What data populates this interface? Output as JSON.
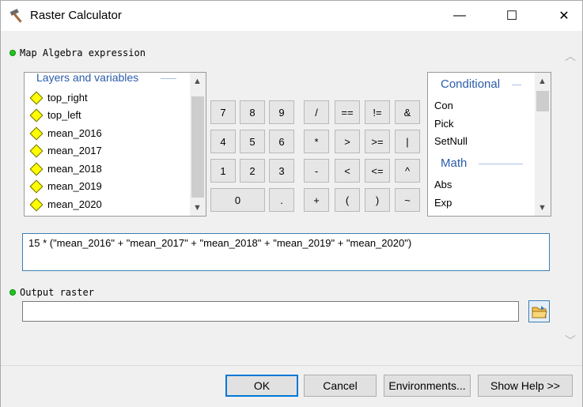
{
  "window": {
    "title": "Raster Calculator",
    "minimize": "—",
    "maximize": "☐",
    "close": "✕"
  },
  "expression_label": "Map Algebra expression",
  "layers": {
    "legend": "Layers and variables",
    "items": [
      "top_right",
      "top_left",
      "mean_2016",
      "mean_2017",
      "mean_2018",
      "mean_2019",
      "mean_2020"
    ]
  },
  "keypad": {
    "rows": [
      [
        "7",
        "8",
        "9",
        "/",
        "==",
        "!=",
        "&"
      ],
      [
        "4",
        "5",
        "6",
        "*",
        ">",
        ">=",
        "|"
      ],
      [
        "1",
        "2",
        "3",
        "-",
        "<",
        "<=",
        "^"
      ],
      [
        "0",
        ".",
        "+",
        "(",
        ")",
        "~"
      ]
    ]
  },
  "functions": {
    "categories": [
      {
        "name": "Conditional",
        "items": [
          "Con",
          "Pick",
          "SetNull"
        ]
      },
      {
        "name": "Math",
        "items": [
          "Abs",
          "Exp"
        ]
      }
    ]
  },
  "expression": "15 * (\"mean_2016\" + \"mean_2017\" + \"mean_2018\" + \"mean_2019\" + \"mean_2020\")",
  "output_label": "Output raster",
  "output_value": "",
  "buttons": {
    "ok": "OK",
    "cancel": "Cancel",
    "environments": "Environments...",
    "show_help": "Show Help >>"
  },
  "colors": {
    "accent": "#0078d7",
    "legend_blue": "#2a5caa",
    "layer_icon": "#ffff00",
    "status_dot": "#1ec81e"
  }
}
